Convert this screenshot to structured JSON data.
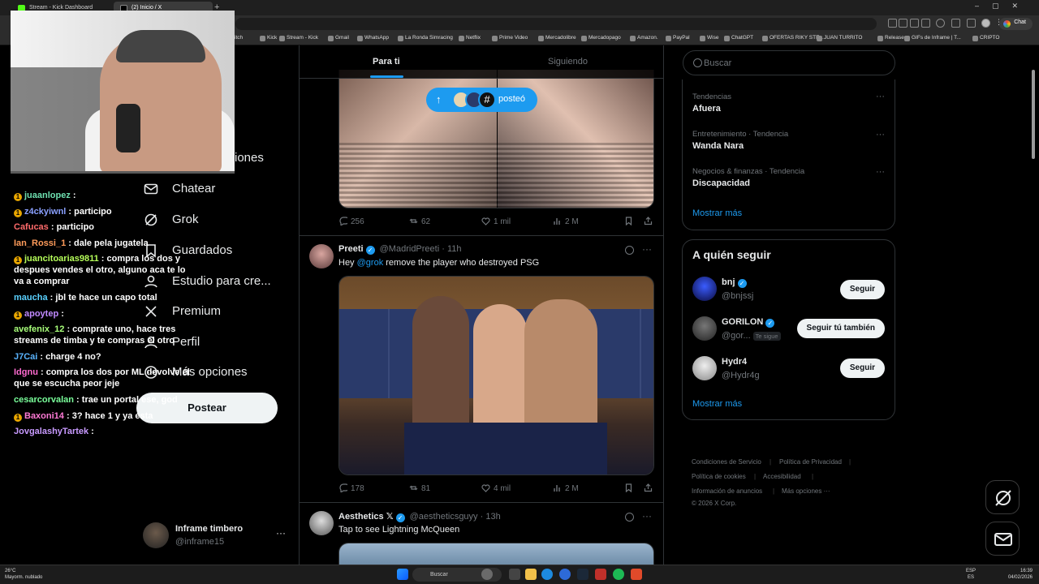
{
  "browser": {
    "tabs": [
      {
        "label": "Stream - Kick Dashboard",
        "active": false
      },
      {
        "label": "(2) Inicio / X",
        "active": true
      }
    ],
    "new_tab_icon": "plus-icon",
    "chat_button": "Chat",
    "bookmarks": [
      "itch",
      "Kick",
      "Stream - Kick",
      "Gmail",
      "WhatsApp",
      "La Ronda Simracing",
      "Netflix",
      "Prime Video",
      "Mercadolibre",
      "Mercadopago",
      "Amazon.",
      "PayPal",
      "Wise",
      "ChatGPT",
      "OFERTAS RIKY STE...",
      "JUAN TURRITO",
      "Releases",
      "GIFs de Inframe | T...",
      "CRIPTO"
    ]
  },
  "chat": [
    {
      "user": "juaanlopez",
      "color": "#6ee0b0",
      "msg": "",
      "badge": true
    },
    {
      "user": "z4ckyiwnl",
      "color": "#8aa0ff",
      "msg": "participo",
      "badge": true
    },
    {
      "user": "Cafucas",
      "color": "#ff6b6b",
      "msg": "participo",
      "badge": false
    },
    {
      "user": "Ian_Rossi_1",
      "color": "#ff9b5a",
      "msg": "dale pela jugatela",
      "badge": false
    },
    {
      "user": "juancitoarias9811",
      "color": "#b6ff5a",
      "msg": "compra los dos y despues vendes el otro, alguno aca te lo va a comprar",
      "badge": true
    },
    {
      "user": "maucha",
      "color": "#5ad1ff",
      "msg": "jbl te hace un capo total",
      "badge": false
    },
    {
      "user": "apoytep",
      "color": "#c08aff",
      "msg": "",
      "badge": true
    },
    {
      "user": "avefenix_12",
      "color": "#a8ff7a",
      "msg": "comprate uno, hace tres streams de timba y te compras el otro",
      "badge": false
    },
    {
      "user": "J7Cai",
      "color": "#5ab4ff",
      "msg": "charge 4 no?",
      "badge": false
    },
    {
      "user": "Idgnu",
      "color": "#ff6bd0",
      "msg": "compra los dos por ML devolve el que se escucha peor jeje",
      "badge": false
    },
    {
      "user": "cesarcorvalan",
      "color": "#7aff9b",
      "msg": "trae un portal ese, god",
      "badge": false
    },
    {
      "user": "Baxoni14",
      "color": "#ff7ad6",
      "msg": "3? hace 1 y ya esta",
      "badge": true
    },
    {
      "user": "JovgalashyTartek",
      "color": "#c89aff",
      "msg": "",
      "badge": false
    }
  ],
  "nav": {
    "items": [
      "iones",
      "Chatear",
      "Grok",
      "Guardados",
      "Estudio para cre...",
      "Premium",
      "Perfil",
      "Más opciones"
    ],
    "post_button": "Postear",
    "account_name": "Inframe timbero",
    "account_handle": "@inframe15",
    "account_more": "···"
  },
  "timeline": {
    "tabs": [
      "Para ti",
      "Siguiendo"
    ],
    "new_posts_label": "posteó",
    "posts": [
      {
        "stats": {
          "replies": "256",
          "reposts": "62",
          "likes": "1 mil",
          "views": "2 M"
        }
      },
      {
        "name": "Preeti",
        "handle": "@MadridPreeti",
        "time": "· 11h",
        "text_prefix": "Hey ",
        "mention": "@grok",
        "text_suffix": " remove the player who destroyed PSG",
        "stats": {
          "replies": "178",
          "reposts": "81",
          "likes": "4 mil",
          "views": "2 M"
        }
      },
      {
        "name": "Aesthetics 𝕏",
        "handle": "@aestheticsguyy",
        "time": "· 13h",
        "text": "Tap to see Lightning McQueen"
      }
    ]
  },
  "right": {
    "search_placeholder": "Buscar",
    "trends": [
      {
        "context": "Tendencias",
        "name": "Afuera"
      },
      {
        "context": "Entretenimiento · Tendencia",
        "name": "Wanda Nara"
      },
      {
        "context": "Negocios & finanzas · Tendencia",
        "name": "Discapacidad"
      }
    ],
    "trends_more": "Mostrar más",
    "who_to_follow_title": "A quién seguir",
    "who_to_follow": [
      {
        "name": "bnj",
        "handle": "@bnjssj",
        "button": "Seguir",
        "follows_you": ""
      },
      {
        "name": "GORILON",
        "handle": "@gor...",
        "button": "Seguir tú también",
        "follows_you": "Te sigue"
      },
      {
        "name": "Hydr4",
        "handle": "@Hydr4g",
        "button": "Seguir",
        "follows_you": ""
      }
    ],
    "wtf_more": "Mostrar más",
    "footer": [
      "Condiciones de Servicio",
      "Política de Privacidad",
      "Política de cookies",
      "Accesibilidad",
      "Información de anuncios",
      "Más opciones ···",
      "© 2026 X Corp."
    ]
  },
  "taskbar": {
    "weather_temp": "26°C",
    "weather_desc": "Mayorm. nublado",
    "search": "Buscar",
    "lang1": "ESP",
    "lang2": "ES",
    "time": "16:39",
    "date": "04/02/2026"
  },
  "colors": {
    "accent": "#1d9bf0",
    "kick": "#53fc18"
  }
}
